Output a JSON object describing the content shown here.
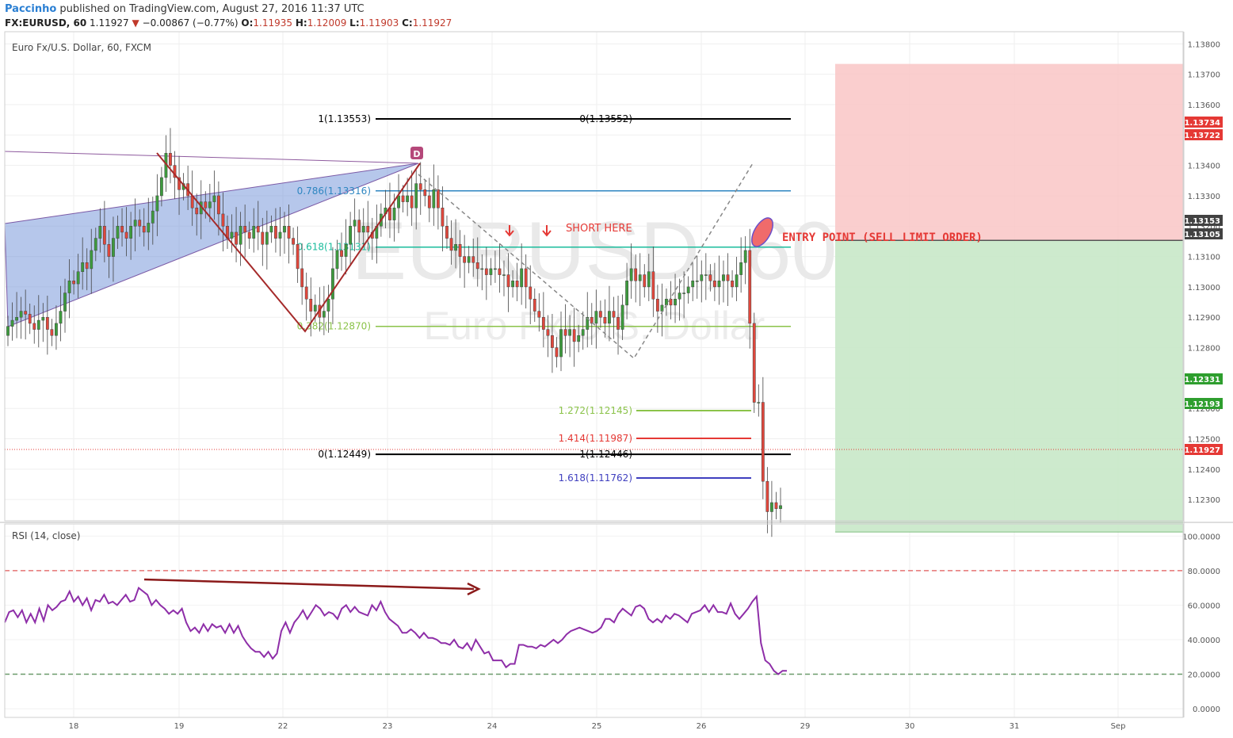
{
  "header": {
    "author": "Paccinho",
    "published": "published on TradingView.com, August 27, 2016 11:37 UTC",
    "symbol": "FX:EURUSD, 60",
    "last": "1.11927",
    "change_arrow": "▼",
    "change": "−0.00867 (−0.77%)",
    "o_label": "O:",
    "o": "1.11935",
    "h_label": "H:",
    "h": "1.12009",
    "l_label": "L:",
    "l": "1.11903",
    "c_label": "C:",
    "c": "1.11927"
  },
  "chart_data": [
    {
      "type": "candlestick",
      "title": "Euro Fx/U.S. Dollar, 60, FXCM",
      "watermark_symbol": "EURUSD, 60",
      "watermark_name": "Euro Fx/U.S. Dollar",
      "x_ticks": [
        "18",
        "19",
        "22",
        "23",
        "24",
        "25",
        "26",
        "29",
        "30",
        "31",
        "Sep"
      ],
      "y_ticks": [
        "1.12300",
        "1.12400",
        "1.12500",
        "1.12600",
        "1.12700",
        "1.12800",
        "1.12900",
        "1.13000",
        "1.13100",
        "1.13200",
        "1.13300",
        "1.13400",
        "1.13500",
        "1.13600",
        "1.13700",
        "1.13800"
      ],
      "ylim": [
        1.1223,
        1.1384
      ],
      "close_series": [
        1.1287,
        1.1289,
        1.129,
        1.1292,
        1.1291,
        1.1288,
        1.1286,
        1.1289,
        1.129,
        1.1286,
        1.1284,
        1.1288,
        1.1292,
        1.1298,
        1.1302,
        1.1301,
        1.1305,
        1.1308,
        1.1306,
        1.1312,
        1.1316,
        1.132,
        1.1314,
        1.131,
        1.1316,
        1.132,
        1.1318,
        1.1316,
        1.132,
        1.1322,
        1.132,
        1.1318,
        1.1321,
        1.1325,
        1.133,
        1.1336,
        1.1344,
        1.134,
        1.1336,
        1.1332,
        1.1334,
        1.133,
        1.1326,
        1.1324,
        1.1328,
        1.1326,
        1.1328,
        1.133,
        1.1324,
        1.132,
        1.1316,
        1.1318,
        1.1314,
        1.132,
        1.1318,
        1.1316,
        1.132,
        1.1318,
        1.1314,
        1.1318,
        1.132,
        1.1316,
        1.1318,
        1.132,
        1.1316,
        1.1314,
        1.1306,
        1.13,
        1.1296,
        1.1292,
        1.1294,
        1.129,
        1.1292,
        1.1296,
        1.1306,
        1.1312,
        1.131,
        1.1314,
        1.132,
        1.1322,
        1.1318,
        1.132,
        1.1318,
        1.1316,
        1.132,
        1.1324,
        1.1326,
        1.1322,
        1.1326,
        1.133,
        1.1328,
        1.133,
        1.1326,
        1.1334,
        1.1332,
        1.133,
        1.1326,
        1.1332,
        1.1326,
        1.132,
        1.1316,
        1.1312,
        1.1314,
        1.131,
        1.1308,
        1.131,
        1.1308,
        1.1306,
        1.1306,
        1.1304,
        1.1306,
        1.1306,
        1.1304,
        1.1304,
        1.13,
        1.1302,
        1.13,
        1.1306,
        1.13,
        1.1296,
        1.1292,
        1.129,
        1.1286,
        1.1284,
        1.128,
        1.1277,
        1.1286,
        1.1284,
        1.1286,
        1.1282,
        1.1284,
        1.1286,
        1.129,
        1.1288,
        1.1292,
        1.129,
        1.1288,
        1.1292,
        1.129,
        1.1286,
        1.1294,
        1.1302,
        1.1306,
        1.1302,
        1.1304,
        1.13,
        1.1305,
        1.1296,
        1.1292,
        1.1294,
        1.1296,
        1.1294,
        1.1296,
        1.1298,
        1.1298,
        1.13,
        1.1302,
        1.1302,
        1.1304,
        1.1304,
        1.1302,
        1.13,
        1.1302,
        1.1304,
        1.1302,
        1.13,
        1.1304,
        1.1308,
        1.1312,
        1.1288,
        1.1262,
        1.1262,
        1.1236,
        1.1226,
        1.1229,
        1.1227,
        1.1228
      ],
      "rsi": {
        "title": "RSI (14, close)",
        "ylim": [
          -5,
          107
        ],
        "y_ticks": [
          "100.0000",
          "80.0000",
          "60.0000",
          "40.0000",
          "20.0000",
          "0.0000"
        ],
        "upper_band": 80,
        "lower_band": 20,
        "values": [
          50,
          56,
          57,
          53,
          57,
          50,
          55,
          50,
          58,
          51,
          60,
          57,
          59,
          62,
          63,
          68,
          62,
          65,
          60,
          64,
          57,
          63,
          62,
          66,
          61,
          62,
          60,
          63,
          66,
          62,
          63,
          70,
          68,
          66,
          60,
          63,
          60,
          58,
          55,
          57,
          55,
          58,
          50,
          45,
          47,
          44,
          49,
          45,
          49,
          47,
          48,
          44,
          49,
          44,
          48,
          42,
          38,
          35,
          33,
          33,
          30,
          33,
          29,
          32,
          45,
          50,
          44,
          50,
          53,
          57,
          52,
          56,
          60,
          58,
          54,
          56,
          55,
          52,
          58,
          60,
          56,
          59,
          56,
          55,
          54,
          60,
          57,
          62,
          56,
          52,
          50,
          48,
          44,
          44,
          46,
          44,
          41,
          44,
          41,
          41,
          40,
          38,
          38,
          37,
          40,
          36,
          35,
          38,
          34,
          40,
          36,
          32,
          33,
          28,
          28,
          28,
          24,
          26,
          26,
          37,
          37,
          36,
          36,
          35,
          37,
          36,
          38,
          40,
          38,
          40,
          43,
          45,
          46,
          47,
          46,
          45,
          44,
          45,
          47,
          52,
          52,
          50,
          55,
          58,
          56,
          54,
          59,
          60,
          58,
          52,
          50,
          52,
          50,
          54,
          52,
          55,
          54,
          52,
          50,
          55,
          56,
          57,
          60,
          56,
          60,
          56,
          56,
          55,
          61,
          55,
          52,
          55,
          58,
          62,
          65,
          38,
          28,
          26,
          22,
          20,
          22,
          22
        ]
      },
      "annotations": {
        "fib_retracement": [
          {
            "label": "1(1.13553)",
            "color": "#000000"
          },
          {
            "label": "0.786(1.13316)",
            "color": "#2e86c1"
          },
          {
            "label": "0.618(1.13131)",
            "color": "#1abc9c"
          },
          {
            "label": "0.382(1.12870)",
            "color": "#8bc34a"
          },
          {
            "label": "0(1.12449)",
            "color": "#000000"
          }
        ],
        "fib_extension": [
          {
            "label": "0(1.13552)",
            "color": "#000000"
          },
          {
            "label": "1(1.12446)",
            "color": "#000000"
          },
          {
            "label": "1.272(1.12145)",
            "color": "#8bc34a"
          },
          {
            "label": "1.414(1.11987)",
            "color": "#e53935"
          },
          {
            "label": "1.618(1.11762)",
            "color": "#3f3fbf"
          }
        ],
        "pattern_point": "D",
        "short_label": "SHORT HERE",
        "entry_label": "ENTRY POINT (SELL LIMIT ORDER)",
        "price_badges": [
          {
            "value": "1.13734",
            "color": "#e53935"
          },
          {
            "value": "1.13722",
            "color": "#e53935"
          },
          {
            "value": "1.13153",
            "color": "#424242"
          },
          {
            "value": "1.13105",
            "color": "#424242"
          },
          {
            "value": "1.12331",
            "color": "#2e9e2e"
          },
          {
            "value": "1.12193",
            "color": "#2e9e2e"
          },
          {
            "value": "1.11927",
            "color": "#e53935"
          }
        ]
      },
      "colors": {
        "up": "#3d9b3d",
        "down": "#e0473c",
        "rsi": "#8e2ea8",
        "triangle": "#6d8fd8",
        "stop_zone": "#f9c6c6",
        "target_zone": "#c8e8c8"
      }
    }
  ]
}
